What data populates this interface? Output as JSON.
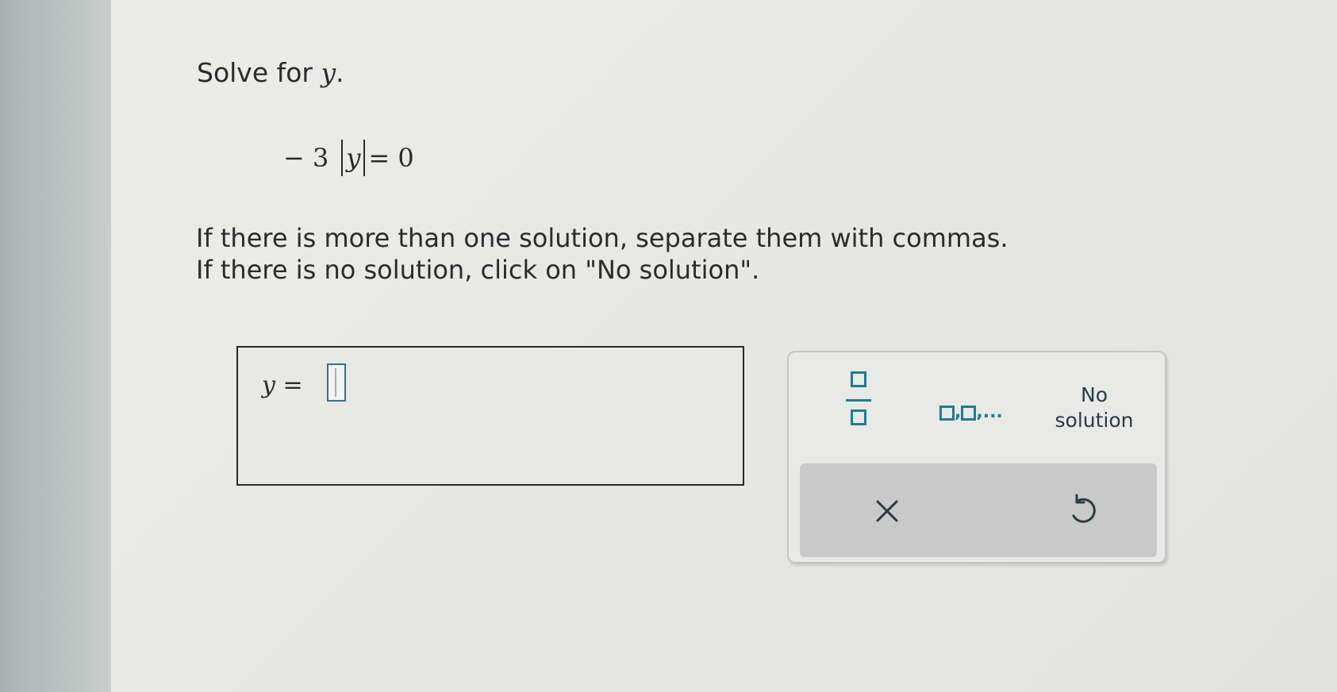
{
  "question": {
    "prompt_text": "Solve for ",
    "prompt_var": "y",
    "prompt_end": ".",
    "equation": {
      "coefficient": "− 3",
      "variable": "y",
      "rhs": "= 0"
    },
    "instruction_line1": "If there is more than one solution, separate them with commas.",
    "instruction_line2": "If there is no solution, click on \"No solution\"."
  },
  "answer": {
    "variable_label": "y =",
    "value": ""
  },
  "keypad": {
    "fraction_icon": "fraction-icon",
    "list_icon": "list-icon",
    "list_separator_1": ",",
    "list_separator_2": ",...",
    "no_solution_line1": "No",
    "no_solution_line2": "solution",
    "clear_icon": "close-x-icon",
    "undo_icon": "undo-icon",
    "accent_color": "#1f7e8a",
    "text_color": "#2d3a3f"
  }
}
